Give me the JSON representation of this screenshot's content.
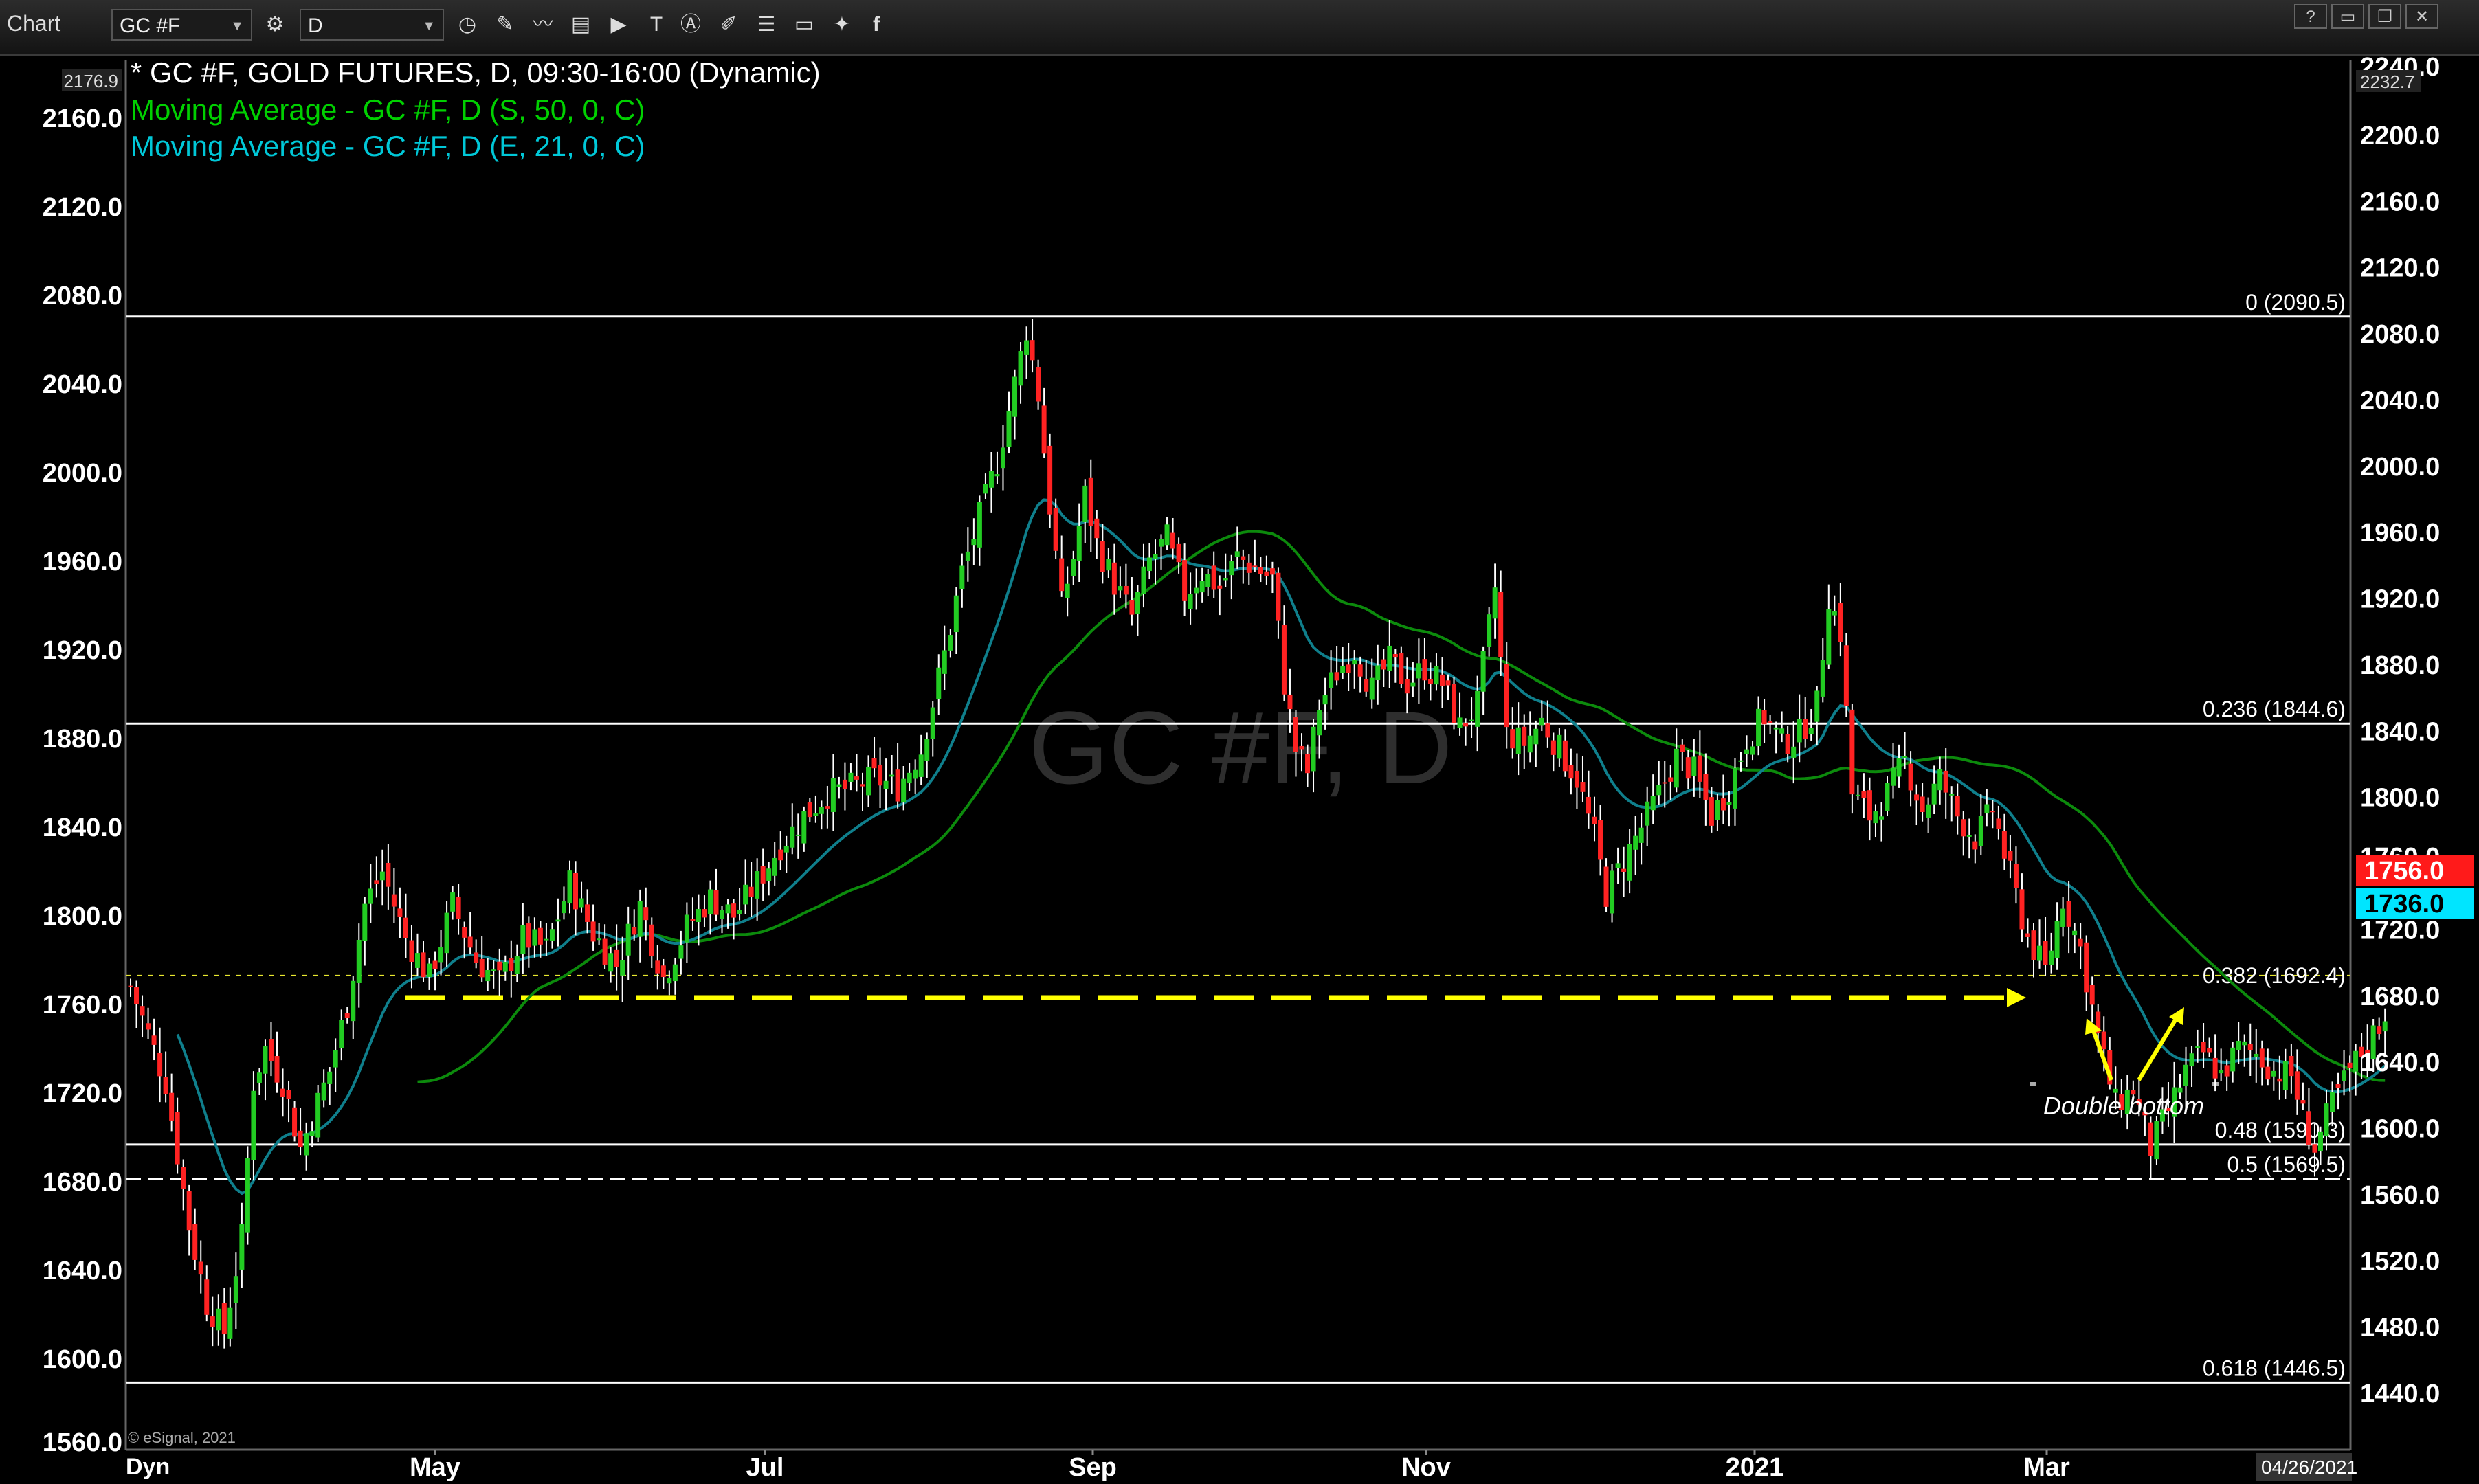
{
  "toolbar": {
    "title": "Chart",
    "symbol": "GC #F",
    "interval": "D",
    "icons": [
      "gear-icon",
      "clock-icon",
      "pencil-icon",
      "line-chart-icon",
      "data-icon",
      "play-icon",
      "text-icon",
      "alert-icon",
      "draw-icon",
      "list-icon",
      "chat-icon",
      "twitter-icon",
      "facebook-icon"
    ],
    "window_buttons": [
      "?",
      "▭",
      "❐",
      "✕"
    ]
  },
  "legend": {
    "main": "* GC #F, GOLD FUTURES, D, 09:30-16:00 (Dynamic)",
    "ma50": "Moving Average - GC #F, D (S, 50, 0, C)",
    "ma21": "Moving Average - GC #F, D (E, 21, 0, C)"
  },
  "colors": {
    "up": "#22cc22",
    "down": "#ff2222",
    "ma50": "#00d000",
    "ma21": "#00c8d8",
    "fib": "#ffffff",
    "fib382": "#e8e830",
    "support": "#ffff00",
    "price_badge": "#ff1a1a",
    "ma_badge": "#00e5ff"
  },
  "chart_data": {
    "type": "candlestick",
    "watermark": "GC #F, D",
    "left_axis": {
      "ticks": [
        2160.0,
        2120.0,
        2080.0,
        2040.0,
        2000.0,
        1960.0,
        1920.0,
        1880.0,
        1840.0,
        1800.0,
        1760.0,
        1720.0,
        1680.0,
        1640.0,
        1600.0
      ],
      "top_marker": "2176.9",
      "cutoff_label": "1560.0"
    },
    "right_axis": {
      "ticks": [
        2200.0,
        2160.0,
        2120.0,
        2080.0,
        2040.0,
        2000.0,
        1960.0,
        1920.0,
        1880.0,
        1840.0,
        1800.0,
        1720.0,
        1680.0,
        1640.0,
        1600.0,
        1560.0,
        1520.0,
        1480.0,
        1440.0
      ],
      "top_label": "2240.0",
      "top_marker": "2232.7",
      "hidden_label": "1760.0"
    },
    "x_labels": [
      "May",
      "Jul",
      "Sep",
      "Nov",
      "2021",
      "Mar"
    ],
    "x_label_prefix": "Dyn",
    "date_badge": "04/26/2021",
    "last_price": "1756.0",
    "ma21_value": "1736.0",
    "fib_levels": [
      {
        "label": "0 (2090.5)",
        "value": 2090.5
      },
      {
        "label": "0.236 (1844.6)",
        "value": 1844.6
      },
      {
        "label": "0.382 (1692.4)",
        "value": 1692.4
      },
      {
        "label": "0.48 (1590.3)",
        "value": 1590.3
      },
      {
        "label": "0.5 (1569.5)",
        "value": 1569.5
      },
      {
        "label": "0.618 (1446.5)",
        "value": 1446.5
      }
    ],
    "annotation": "Double bottom",
    "copyright": "© eSignal, 2021",
    "price_path": [
      {
        "d": 0,
        "c": 1768
      },
      {
        "d": 6,
        "c": 1725
      },
      {
        "d": 10,
        "c": 1660
      },
      {
        "d": 13,
        "c": 1625
      },
      {
        "d": 16,
        "c": 1612
      },
      {
        "d": 19,
        "c": 1655
      },
      {
        "d": 21,
        "c": 1725
      },
      {
        "d": 23,
        "c": 1740
      },
      {
        "d": 26,
        "c": 1725
      },
      {
        "d": 29,
        "c": 1695
      },
      {
        "d": 34,
        "c": 1730
      },
      {
        "d": 37,
        "c": 1760
      },
      {
        "d": 40,
        "c": 1805
      },
      {
        "d": 43,
        "c": 1820
      },
      {
        "d": 47,
        "c": 1790
      },
      {
        "d": 51,
        "c": 1772
      },
      {
        "d": 55,
        "c": 1805
      },
      {
        "d": 59,
        "c": 1780
      },
      {
        "d": 63,
        "c": 1770
      },
      {
        "d": 67,
        "c": 1790
      },
      {
        "d": 71,
        "c": 1785
      },
      {
        "d": 75,
        "c": 1815
      },
      {
        "d": 79,
        "c": 1792
      },
      {
        "d": 83,
        "c": 1778
      },
      {
        "d": 87,
        "c": 1805
      },
      {
        "d": 91,
        "c": 1772
      },
      {
        "d": 95,
        "c": 1795
      },
      {
        "d": 99,
        "c": 1808
      },
      {
        "d": 103,
        "c": 1800
      },
      {
        "d": 107,
        "c": 1815
      },
      {
        "d": 111,
        "c": 1832
      },
      {
        "d": 115,
        "c": 1845
      },
      {
        "d": 119,
        "c": 1855
      },
      {
        "d": 123,
        "c": 1858
      },
      {
        "d": 127,
        "c": 1862
      },
      {
        "d": 131,
        "c": 1858
      },
      {
        "d": 135,
        "c": 1875
      },
      {
        "d": 139,
        "c": 1918
      },
      {
        "d": 142,
        "c": 1955
      },
      {
        "d": 145,
        "c": 1980
      },
      {
        "d": 148,
        "c": 2005
      },
      {
        "d": 151,
        "c": 2040
      },
      {
        "d": 153,
        "c": 2065
      },
      {
        "d": 155,
        "c": 2035
      },
      {
        "d": 157,
        "c": 1985
      },
      {
        "d": 159,
        "c": 1940
      },
      {
        "d": 161,
        "c": 1962
      },
      {
        "d": 163,
        "c": 1990
      },
      {
        "d": 165,
        "c": 1968
      },
      {
        "d": 168,
        "c": 1950
      },
      {
        "d": 171,
        "c": 1935
      },
      {
        "d": 174,
        "c": 1960
      },
      {
        "d": 177,
        "c": 1970
      },
      {
        "d": 180,
        "c": 1945
      },
      {
        "d": 183,
        "c": 1955
      },
      {
        "d": 186,
        "c": 1948
      },
      {
        "d": 189,
        "c": 1962
      },
      {
        "d": 192,
        "c": 1957
      },
      {
        "d": 195,
        "c": 1952
      },
      {
        "d": 197,
        "c": 1905
      },
      {
        "d": 199,
        "c": 1875
      },
      {
        "d": 201,
        "c": 1865
      },
      {
        "d": 203,
        "c": 1895
      },
      {
        "d": 206,
        "c": 1910
      },
      {
        "d": 209,
        "c": 1920
      },
      {
        "d": 212,
        "c": 1902
      },
      {
        "d": 215,
        "c": 1915
      },
      {
        "d": 218,
        "c": 1905
      },
      {
        "d": 221,
        "c": 1912
      },
      {
        "d": 224,
        "c": 1905
      },
      {
        "d": 227,
        "c": 1885
      },
      {
        "d": 230,
        "c": 1895
      },
      {
        "d": 233,
        "c": 1948
      },
      {
        "d": 235,
        "c": 1882
      },
      {
        "d": 238,
        "c": 1878
      },
      {
        "d": 241,
        "c": 1888
      },
      {
        "d": 244,
        "c": 1875
      },
      {
        "d": 247,
        "c": 1862
      },
      {
        "d": 250,
        "c": 1835
      },
      {
        "d": 252,
        "c": 1810
      },
      {
        "d": 255,
        "c": 1825
      },
      {
        "d": 258,
        "c": 1840
      },
      {
        "d": 261,
        "c": 1855
      },
      {
        "d": 264,
        "c": 1872
      },
      {
        "d": 267,
        "c": 1865
      },
      {
        "d": 270,
        "c": 1845
      },
      {
        "d": 273,
        "c": 1858
      },
      {
        "d": 276,
        "c": 1880
      },
      {
        "d": 279,
        "c": 1890
      },
      {
        "d": 282,
        "c": 1878
      },
      {
        "d": 285,
        "c": 1882
      },
      {
        "d": 288,
        "c": 1895
      },
      {
        "d": 290,
        "c": 1945
      },
      {
        "d": 292,
        "c": 1928
      },
      {
        "d": 294,
        "c": 1855
      },
      {
        "d": 297,
        "c": 1845
      },
      {
        "d": 300,
        "c": 1855
      },
      {
        "d": 303,
        "c": 1870
      },
      {
        "d": 306,
        "c": 1848
      },
      {
        "d": 309,
        "c": 1862
      },
      {
        "d": 312,
        "c": 1845
      },
      {
        "d": 315,
        "c": 1835
      },
      {
        "d": 318,
        "c": 1848
      },
      {
        "d": 321,
        "c": 1818
      },
      {
        "d": 324,
        "c": 1790
      },
      {
        "d": 327,
        "c": 1775
      },
      {
        "d": 330,
        "c": 1808
      },
      {
        "d": 333,
        "c": 1785
      },
      {
        "d": 336,
        "c": 1745
      },
      {
        "d": 339,
        "c": 1715
      },
      {
        "d": 342,
        "c": 1722
      },
      {
        "d": 345,
        "c": 1695
      },
      {
        "d": 348,
        "c": 1712
      },
      {
        "d": 351,
        "c": 1730
      },
      {
        "d": 354,
        "c": 1738
      },
      {
        "d": 357,
        "c": 1728
      },
      {
        "d": 360,
        "c": 1740
      },
      {
        "d": 363,
        "c": 1738
      },
      {
        "d": 366,
        "c": 1730
      },
      {
        "d": 369,
        "c": 1728
      },
      {
        "d": 371,
        "c": 1710
      },
      {
        "d": 373,
        "c": 1695
      },
      {
        "d": 376,
        "c": 1715
      },
      {
        "d": 379,
        "c": 1730
      },
      {
        "d": 382,
        "c": 1742
      },
      {
        "d": 385,
        "c": 1756
      }
    ]
  }
}
